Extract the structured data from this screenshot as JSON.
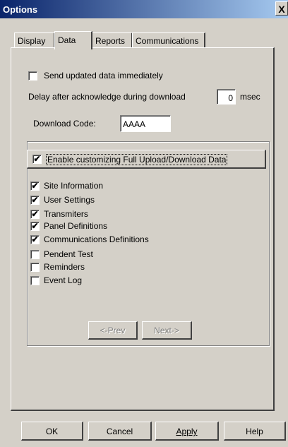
{
  "window": {
    "title": "Options",
    "close_glyph": "X"
  },
  "tabs": [
    {
      "label": "Display",
      "active": false
    },
    {
      "label": "Data",
      "active": true
    },
    {
      "label": "Reports",
      "active": false
    },
    {
      "label": "Communications",
      "active": false
    }
  ],
  "data_tab": {
    "send_updated": {
      "label": "Send updated data immediately",
      "checked": false
    },
    "delay": {
      "label": "Delay after acknowledge during download",
      "value": "0",
      "unit": "msec"
    },
    "download_code": {
      "label": "Download Code:",
      "value": "AAAA"
    },
    "enable_customizing": {
      "label": "Enable customizing Full Upload/Download Data",
      "checked": true
    },
    "items": [
      {
        "label": "Site Information",
        "checked": true
      },
      {
        "label": "User Settings",
        "checked": true
      },
      {
        "label": "Transmiters",
        "checked": true
      },
      {
        "label": "Panel Definitions",
        "checked": true
      },
      {
        "label": "Communications Definitions",
        "checked": true
      },
      {
        "label": "Pendent Test",
        "checked": false
      },
      {
        "label": "Reminders",
        "checked": false
      },
      {
        "label": "Event Log",
        "checked": false
      }
    ],
    "prev_label": "<-Prev",
    "next_label": "Next->"
  },
  "buttons": {
    "ok": "OK",
    "cancel": "Cancel",
    "apply": "Apply",
    "help": "Help"
  },
  "check_glyph": "✔"
}
